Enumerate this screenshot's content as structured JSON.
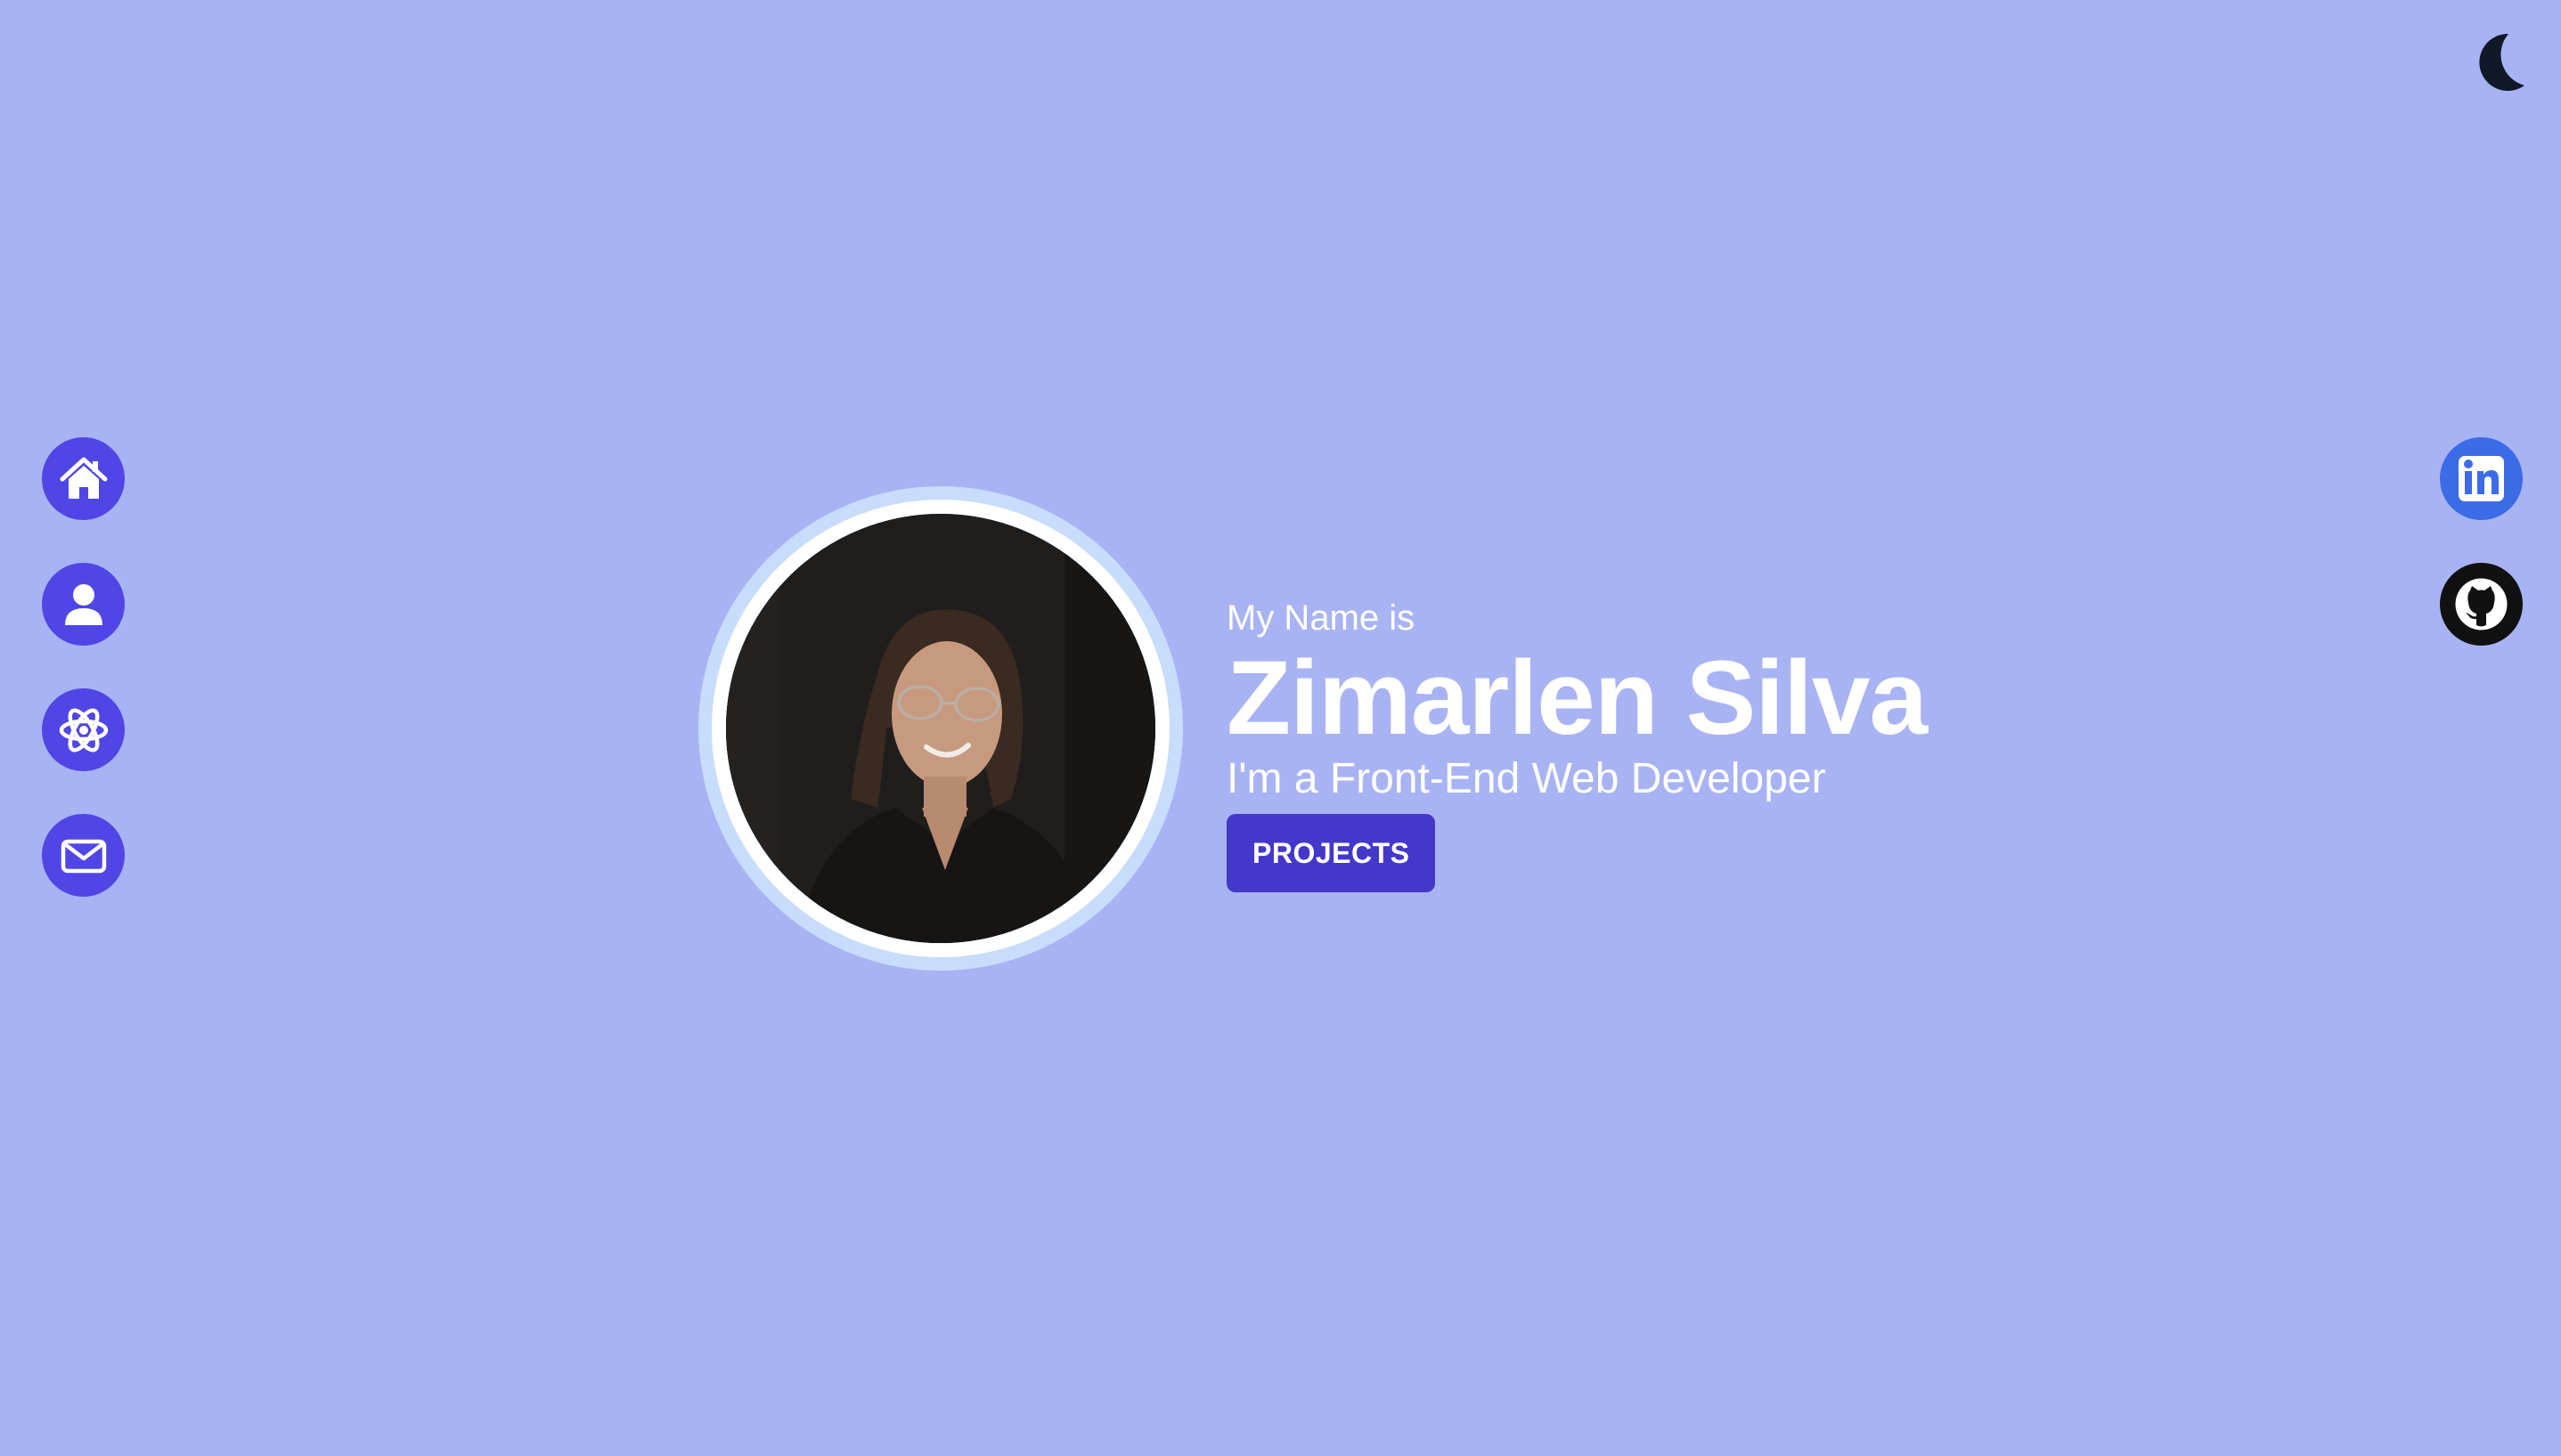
{
  "theme_toggle": {
    "icon": "moon-icon",
    "color": "#111827"
  },
  "side_nav": {
    "color": "#4f46e5",
    "items": [
      {
        "icon": "home-icon"
      },
      {
        "icon": "user-icon"
      },
      {
        "icon": "atom-icon"
      },
      {
        "icon": "mail-icon"
      }
    ]
  },
  "social": [
    {
      "icon": "linkedin-icon",
      "color": "#3b6be6"
    },
    {
      "icon": "github-icon",
      "color": "#111111"
    }
  ],
  "hero": {
    "greeting": "My Name is",
    "name": "Zimarlen Silva",
    "role": "I'm a Front-End Web Developer",
    "projects_label": "PROJECTS"
  },
  "colors": {
    "background": "#a8b3f4",
    "button": "#4338ca",
    "photo_ring": "#c8dcfb"
  }
}
